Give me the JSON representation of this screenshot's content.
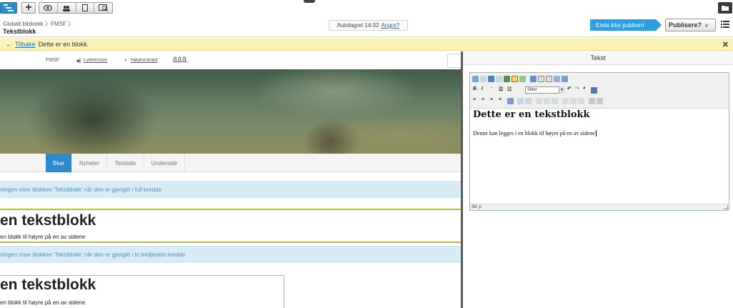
{
  "topbar": {
    "breadcrumb": "Globalt bibliotek 〉FMSF 〉",
    "page_title": "Tekstblokk",
    "autosave_text": "Autolagret 14:32",
    "autosave_undo": "Angre?",
    "publish_status": "Enda ikke publisert",
    "publish_button": "Publisere?",
    "icons": [
      "sitetree-icon",
      "add-icon",
      "preview-eye-icon",
      "visitor-group-icon",
      "device-icon",
      "compare-icon",
      "folder-icon",
      "list-icon"
    ]
  },
  "notice": {
    "back_link": "Tilbake",
    "message": "Dette er en blokk."
  },
  "site_header": {
    "label": "FMSF",
    "audio": "Lydversion",
    "contrast": "Høykontrast",
    "text_size": "aaa"
  },
  "nav": {
    "items": [
      "Blue",
      "Nyheter",
      "Testside",
      "Underside"
    ]
  },
  "preview": {
    "info_full": "ningen viser blokken 'Tekstblokk' når den er gjengitt i full bredde",
    "title_full": "en tekstblokk",
    "text_full": "en blokk til høyre på en av sidene",
    "info_third": "ningen viser blokken 'Tekstblokk' når den er gjengitt i to tredjedels bredde",
    "title_third": "en tekstblokk",
    "text_third": "en blokk til høyre på en av sidene"
  },
  "panel": {
    "title": "Tekst",
    "styles_label": "Stiler",
    "heading": "Dette er en tekstblokk",
    "body": "Denne kan legges i en blokk til høyre på en av sidene",
    "path": "Sti: p"
  },
  "colors": {
    "accent": "#2a8ccf",
    "notice_bg": "#fbf3b5",
    "info_bg": "#d8ecf7"
  }
}
